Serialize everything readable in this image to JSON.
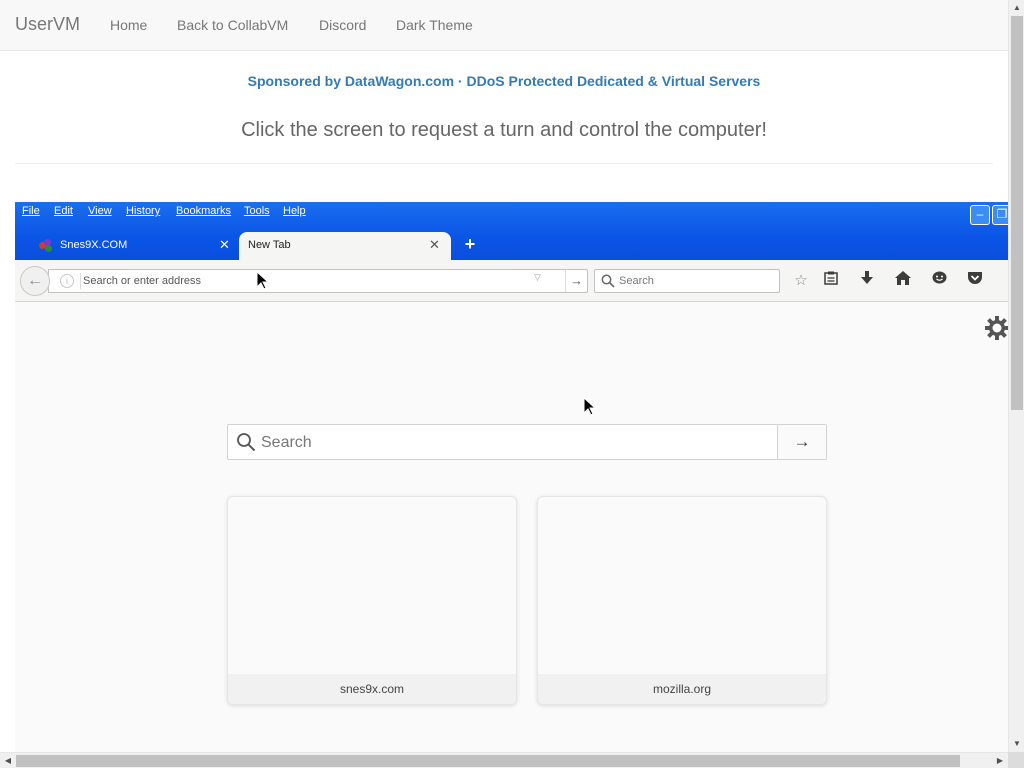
{
  "navbar": {
    "brand": "UserVM",
    "links": [
      "Home",
      "Back to CollabVM",
      "Discord",
      "Dark Theme"
    ]
  },
  "sponsor_text": "Sponsored by DataWagon.com · DDoS Protected Dedicated & Virtual Servers",
  "instruction_text": "Click the screen to request a turn and control the computer!",
  "vm": {
    "menu": [
      "File",
      "Edit",
      "View",
      "History",
      "Bookmarks",
      "Tools",
      "Help"
    ],
    "tabs": [
      {
        "label": "Snes9X.COM",
        "active": false
      },
      {
        "label": "New Tab",
        "active": true
      }
    ],
    "toolbar": {
      "url_placeholder": "Search or enter address",
      "search_placeholder": "Search"
    },
    "new_tab_page": {
      "search_placeholder": "Search",
      "tiles": [
        {
          "label": "snes9x.com"
        },
        {
          "label": "mozilla.org"
        }
      ]
    }
  },
  "colors": {
    "titlebar_blue": "#0b55e6",
    "sponsor_link": "#337ab7",
    "navbar_bg": "#f8f8f8"
  },
  "icons": [
    "back-arrow-icon",
    "info-icon",
    "dropdown-icon",
    "go-arrow-icon",
    "search-icon",
    "bookmark-star-icon",
    "reading-list-icon",
    "download-icon",
    "home-icon",
    "chat-icon",
    "pocket-icon",
    "gear-icon",
    "close-icon",
    "plus-icon",
    "minimize-icon",
    "restore-icon"
  ]
}
